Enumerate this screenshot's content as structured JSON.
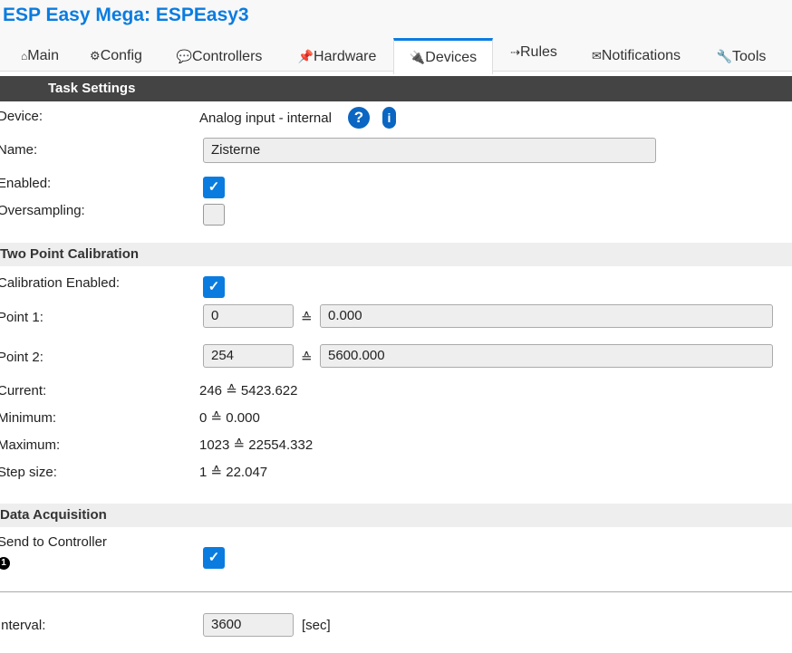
{
  "header": {
    "title": "ESP Easy Mega: ESPEasy3"
  },
  "tabs": [
    {
      "icon": "⌂",
      "label": "Main"
    },
    {
      "icon": "⚙",
      "label": "Config"
    },
    {
      "icon": "💬",
      "label": "Controllers"
    },
    {
      "icon": "📌",
      "label": "Hardware"
    },
    {
      "icon": "🔌",
      "label": "Devices"
    },
    {
      "icon": "⇢",
      "label": "Rules"
    },
    {
      "icon": "✉",
      "label": "Notifications"
    },
    {
      "icon": "🔧",
      "label": "Tools"
    }
  ],
  "task": {
    "heading": "Task Settings",
    "device_label": "Device:",
    "device_value": "Analog input - internal",
    "name_label": "Name:",
    "name_value": "Zisterne",
    "enabled_label": "Enabled:",
    "oversampling_label": "Oversampling:"
  },
  "calibration": {
    "heading": "Two Point Calibration",
    "enabled_label": "Calibration Enabled:",
    "point1_label": "Point 1:",
    "point1_adc": "0",
    "point1_value": "0.000",
    "point2_label": "Point 2:",
    "point2_adc": "254",
    "point2_value": "5600.000",
    "eq": "≙",
    "current_label": "Current:",
    "current_value": "246 ≙ 5423.622",
    "minimum_label": "Minimum:",
    "minimum_value": "0 ≙ 0.000",
    "maximum_label": "Maximum:",
    "maximum_value": "1023 ≙ 22554.332",
    "step_label": "Step size:",
    "step_value": "1 ≙ 22.047"
  },
  "acquisition": {
    "heading": "Data Acquisition",
    "send_label": "Send to Controller",
    "controller_num": "1",
    "interval_label": "Interval:",
    "interval_value": "3600",
    "interval_unit": "[sec]"
  }
}
